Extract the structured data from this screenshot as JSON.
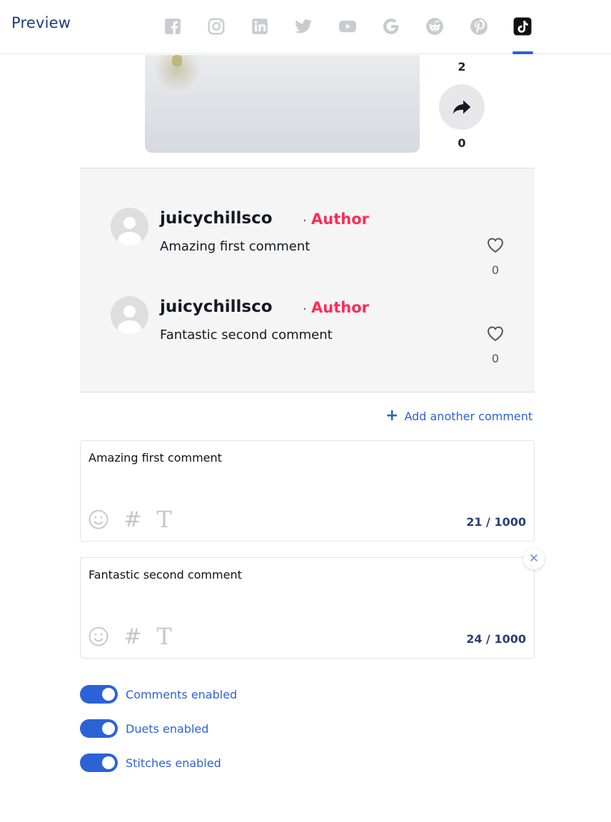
{
  "header": {
    "title": "Preview",
    "networks": [
      {
        "name": "facebook-icon",
        "active": false
      },
      {
        "name": "instagram-icon",
        "active": false
      },
      {
        "name": "linkedin-icon",
        "active": false
      },
      {
        "name": "twitter-icon",
        "active": false
      },
      {
        "name": "youtube-icon",
        "active": false
      },
      {
        "name": "google-icon",
        "active": false
      },
      {
        "name": "reddit-icon",
        "active": false
      },
      {
        "name": "pinterest-icon",
        "active": false
      },
      {
        "name": "tiktok-icon",
        "active": true
      }
    ]
  },
  "video": {
    "like_count": "2",
    "share_count": "0",
    "share_icon": "share-arrow-icon"
  },
  "comments": [
    {
      "user": "juicychillsco",
      "separator": "·",
      "badge": "Author",
      "text": "Amazing first comment",
      "likes": "0"
    },
    {
      "user": "juicychillsco",
      "separator": "·",
      "badge": "Author",
      "text": "Fantastic second comment",
      "likes": "0"
    }
  ],
  "add_comment": {
    "label": "Add another comment"
  },
  "editors": [
    {
      "text": "Amazing first comment",
      "counter": "21 / 1000",
      "removable": false
    },
    {
      "text": "Fantastic second comment",
      "counter": "24 / 1000",
      "removable": true
    }
  ],
  "toggles": [
    {
      "label": "Comments enabled",
      "on": true
    },
    {
      "label": "Duets enabled",
      "on": true
    },
    {
      "label": "Stitches enabled",
      "on": true
    }
  ],
  "colors": {
    "accent": "#2b62d6",
    "author_badge": "#fe2c55",
    "header_title": "#1f3a7a",
    "panel_bg": "#f5f5f6",
    "icon_inactive": "#c9cbd0"
  }
}
